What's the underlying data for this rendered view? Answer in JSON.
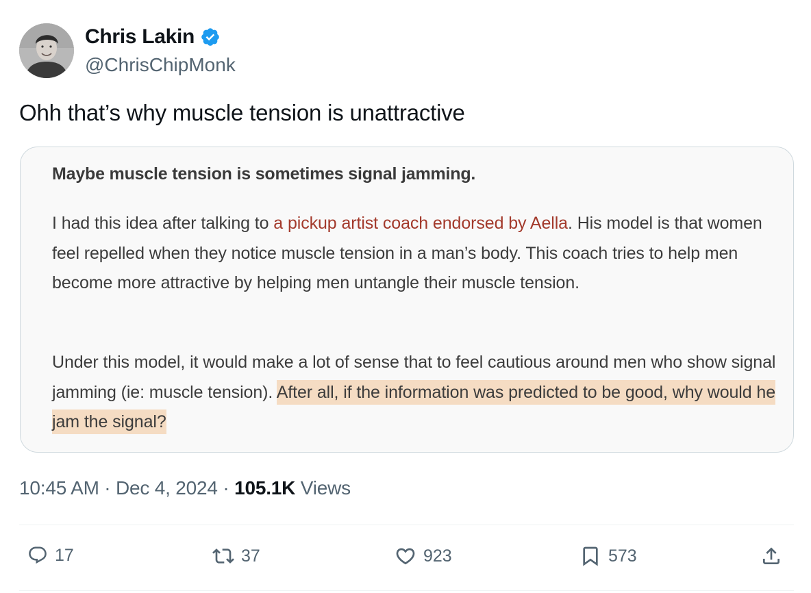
{
  "author": {
    "display_name": "Chris Lakin",
    "handle": "@ChrisChipMonk",
    "verified_color": "#1d9bf0"
  },
  "tweet": {
    "text": "Ohh that’s why muscle tension is unattractive"
  },
  "quote_image": {
    "heading": "Maybe muscle tension is sometimes signal jamming.",
    "p1_before_link": "I had this idea after talking to ",
    "p1_link": "a pickup artist coach endorsed by Aella",
    "p1_after_link": ". His model is that women feel repelled when they notice muscle tension in a man’s body. This coach tries to help men become more attractive by helping men untangle their muscle tension.",
    "p2_before_highlight": "Under this model, it would make a lot of sense that to feel cautious around men who show signal jamming (ie: muscle tension). ",
    "p2_highlight": "After all, if the information was predicted to be good, why would he jam the signal?",
    "link_color": "#a33a2c",
    "highlight_color": "#f5dcc3"
  },
  "meta": {
    "time": "10:45 AM",
    "separator": " · ",
    "date": "Dec 4, 2024",
    "views_count": "105.1K",
    "views_label": " Views"
  },
  "actions": {
    "replies": "17",
    "reposts": "37",
    "likes": "923",
    "bookmarks": "573",
    "icons": [
      "reply-icon",
      "repost-icon",
      "like-icon",
      "bookmark-icon",
      "share-icon"
    ]
  }
}
